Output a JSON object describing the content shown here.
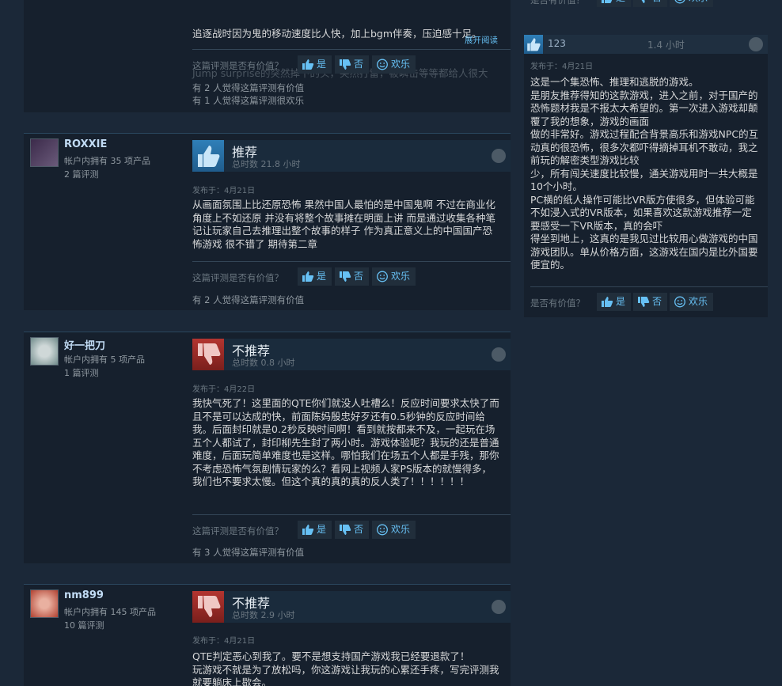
{
  "vote_labels": {
    "question": "这篇评测是否有价值？",
    "side_question": "是否有价值？",
    "yes": "是",
    "no": "否",
    "funny": "欢乐"
  },
  "top_partial": {
    "line1": "追逐战时因为鬼的移动速度比人快，加上bgm伴奏，压迫感十足。",
    "line2": "Jump surprise的突然掉下的头，突然打雷，被瞬击等等都给人很大",
    "read_more": "展开阅读",
    "count_helpful": "有 2 人觉得这篇评测有价值",
    "count_funny": "有 1 人觉得这篇评测很欢乐"
  },
  "reviews": [
    {
      "author": "ROXXIE",
      "products": "帐户内拥有 35 项产品",
      "reviews_count": "2 篇评测",
      "verdict": "推荐",
      "hours": "总时数 21.8 小时",
      "posted": "发布于：4月21日",
      "body": "从画面氛围上比还原恐怖 果然中国人最怕的是中国鬼啊 不过在商业化角度上不如还原 并没有将整个故事摊在明面上讲 而是通过收集各种笔记让玩家自己去推理出整个故事的样子 作为真正意义上的中国国产恐怖游戏 很不错了 期待第二章",
      "count_helpful": "有 2 人觉得这篇评测有价值"
    },
    {
      "author": "好一把刀",
      "products": "帐户内拥有 5 项产品",
      "reviews_count": "1 篇评测",
      "verdict": "不推荐",
      "hours": "总时数 0.8 小时",
      "posted": "发布于：4月22日",
      "body": "我快气死了！这里面的QTE你们就没人吐槽么！反应时间要求太快了而且不是可以达成的快，前面陈妈殷忠好歹还有0.5秒钟的反应时间给我。后面封印就是0.2秒反映时间啊！看到就按都来不及，一起玩在场五个人都试了，封印柳先生封了两小时。游戏体验呢？我玩的还是普通难度，后面玩简单难度也是这样。哪怕我们在场五个人都是手残，那你不考虑恐怖气氛剧情玩家的么？看网上视频人家PS版本的就慢得多，我们也不要求太慢。但这个真的真的真的反人类了！！！！！！",
      "count_helpful": "有 3 人觉得这篇评测有价值"
    },
    {
      "author": "nm899",
      "products": "帐户内拥有 145 项产品",
      "reviews_count": "10 篇评测",
      "verdict": "不推荐",
      "hours": "总时数 2.9 小时",
      "posted": "发布于：4月21日",
      "body": "QTE判定恶心到我了。要不是想支持国产游戏我已经要退款了！\n玩游戏不就是为了放松吗，你这游戏让我玩的心累还手疼，写完评测我就要躺床上歇会。"
    }
  ],
  "side_top": {
    "question": "是否有价值？",
    "yes": "是",
    "no": "否",
    "funny": "欢乐"
  },
  "side_review": {
    "author": "123",
    "hours": "1.4 小时",
    "posted": "发布于：4月21日",
    "body": "这是一个集恐怖、推理和逃脱的游戏。\n是朋友推荐得知的这款游戏，进入之前，对于国产的恐怖题材我是不报太大希望的。第一次进入游戏却颠覆了我的想象，游戏的画面\n做的非常好。游戏过程配合背景高乐和游戏NPC的互动真的很恐怖，很多次都吓得摘掉耳机不敢动，我之前玩的解密类型游戏比较\n少，所有闯关速度比较慢，通关游戏用时一共大概是10个小时。\nPC横的纸人操作可能比VR版方使很多，但体验可能不如浸入式的VR版本，如果喜欢这款游戏推荐一定要感受一下VR版本，真的会吓\n得坐到地上，这真的是我见过比较用心做游戏的中国游戏团队。单从价格方面，这游戏在国内是比外国要便宜的。"
  }
}
